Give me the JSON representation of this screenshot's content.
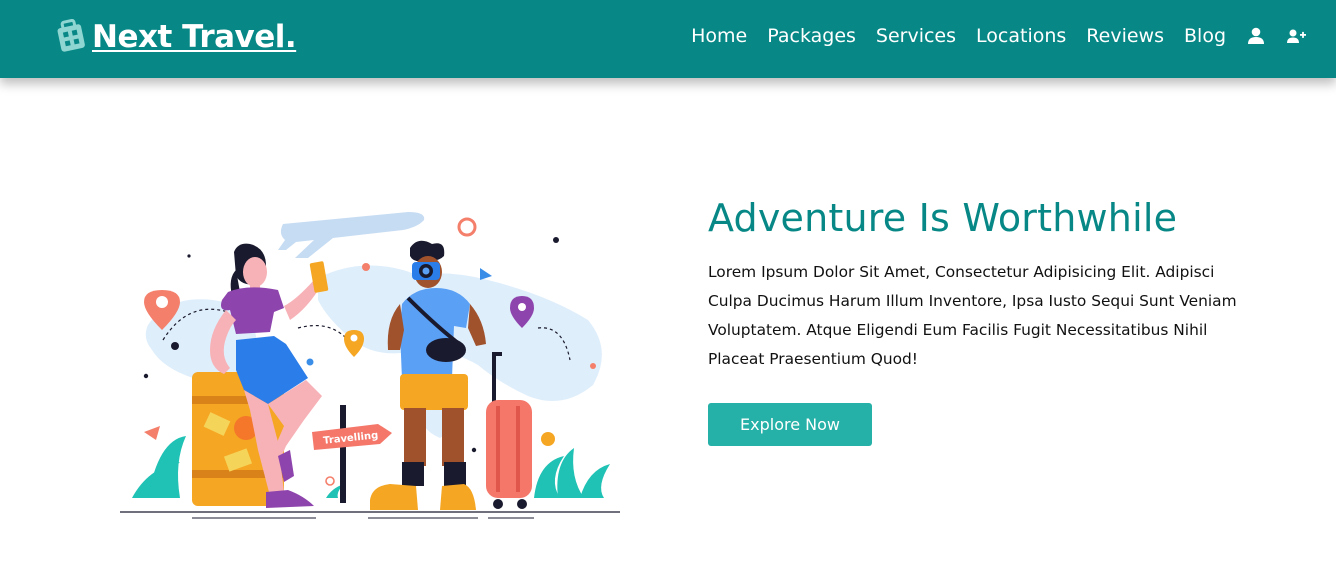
{
  "brand": {
    "name": " Next Travel.",
    "icon": "luggage-icon"
  },
  "nav": {
    "links": [
      "Home",
      "Packages",
      "Services",
      "Locations",
      "Reviews",
      "Blog"
    ],
    "icons": [
      "user-icon",
      "user-plus-icon"
    ]
  },
  "hero": {
    "title": "Adventure Is Worthwhile",
    "text": "Lorem Ipsum Dolor Sit Amet, Consectetur Adipisicing Elit. Adipisci Culpa Ducimus Harum Illum Inventore, Ipsa Iusto Sequi Sunt Veniam Voluptatem. Atque Eligendi Eum Facilis Fugit Necessitatibus Nihil Placeat Praesentium Quod!",
    "button_label": "Explore Now",
    "illustration_sign": "Travelling"
  },
  "colors": {
    "primary": "#078886",
    "button": "#25b1a7",
    "text": "#111111",
    "background": "#ffffff"
  }
}
